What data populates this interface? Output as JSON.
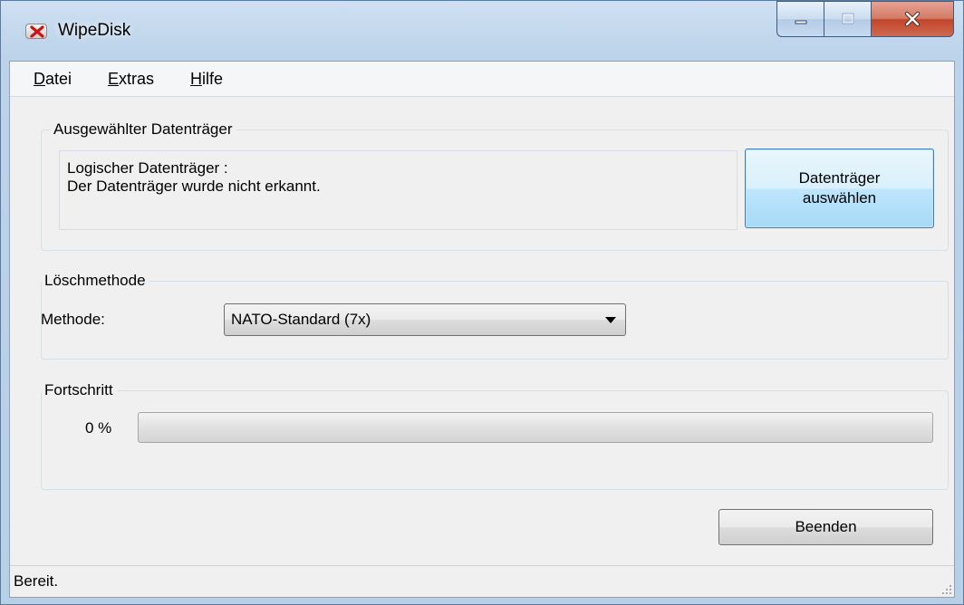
{
  "window": {
    "title": "WipeDisk",
    "icon": "wipedisk-app-icon",
    "controls": {
      "minimize": "minimize-icon",
      "maximize": "maximize-icon",
      "close": "close-icon"
    }
  },
  "menu": {
    "items": [
      {
        "label": "Datei",
        "mnemonic": "D",
        "rest": "atei"
      },
      {
        "label": "Extras",
        "mnemonic": "E",
        "rest": "xtras"
      },
      {
        "label": "Hilfe",
        "mnemonic": "H",
        "rest": "ilfe"
      }
    ]
  },
  "selected_disk": {
    "group_title": "Ausgewählter Datenträger",
    "line1": "Logischer Datenträger :",
    "line2": "Der Datenträger wurde nicht erkannt.",
    "button_line1": "Datenträger",
    "button_line2": "auswählen"
  },
  "wipe_method": {
    "group_title": "Löschmethode",
    "label": "Methode:",
    "selected": "NATO-Standard (7x)"
  },
  "progress": {
    "group_title": "Fortschritt",
    "percent_text": "0 %",
    "value": 0
  },
  "actions": {
    "exit_label": "Beenden"
  },
  "status": {
    "text": "Bereit."
  },
  "colors": {
    "accent": "#3c7fb1",
    "close_button": "#c2452c",
    "progress_fill": "#37b24a"
  }
}
